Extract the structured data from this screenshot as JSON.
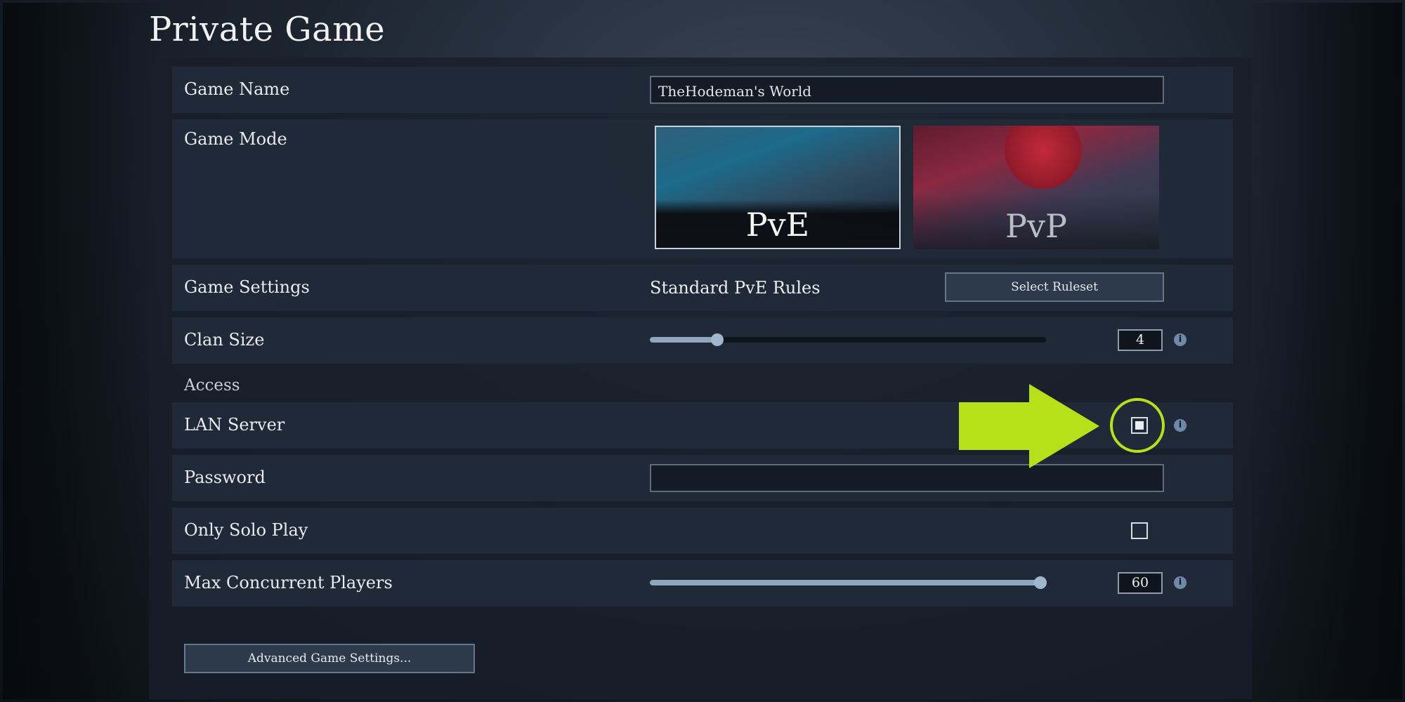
{
  "window": {
    "title": "Private Game"
  },
  "rows": {
    "game_name": {
      "label": "Game Name",
      "value": "TheHodeman's World"
    },
    "game_mode": {
      "label": "Game Mode",
      "options": [
        {
          "label": "PvE",
          "selected": true
        },
        {
          "label": "PvP",
          "selected": false
        }
      ]
    },
    "game_settings": {
      "label": "Game Settings",
      "ruleset": "Standard PvE Rules",
      "button": "Select Ruleset"
    },
    "clan_size": {
      "label": "Clan Size",
      "value": "4",
      "slider_fraction": 0.17
    },
    "access_section": "Access",
    "lan_server": {
      "label": "LAN Server",
      "checked": true
    },
    "password": {
      "label": "Password",
      "value": ""
    },
    "only_solo_play": {
      "label": "Only Solo Play",
      "checked": false
    },
    "max_players": {
      "label": "Max Concurrent Players",
      "value": "60",
      "slider_fraction": 0.985
    }
  },
  "footer": {
    "advanced_button": "Advanced Game Settings..."
  },
  "annotation": {
    "arrow_color": "#b6e11a"
  },
  "icons": {
    "info": "info-icon"
  },
  "info_glyph": "i"
}
